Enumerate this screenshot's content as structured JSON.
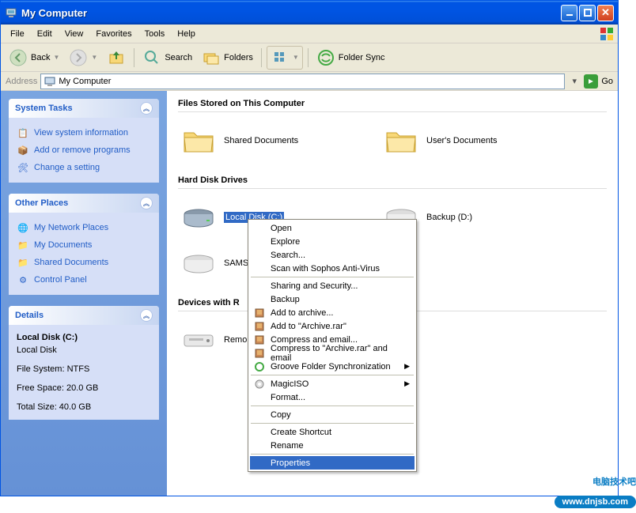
{
  "title": "My Computer",
  "menu": [
    "File",
    "Edit",
    "View",
    "Favorites",
    "Tools",
    "Help"
  ],
  "toolbar": {
    "back": "Back",
    "search": "Search",
    "folders": "Folders",
    "sync": "Folder Sync"
  },
  "address": {
    "label": "Address",
    "value": "My Computer",
    "go": "Go"
  },
  "sidebar": {
    "tasks": {
      "title": "System Tasks",
      "items": [
        "View system information",
        "Add or remove programs",
        "Change a setting"
      ]
    },
    "places": {
      "title": "Other Places",
      "items": [
        "My Network Places",
        "My Documents",
        "Shared Documents",
        "Control Panel"
      ]
    },
    "details": {
      "title": "Details",
      "name": "Local Disk (C:)",
      "type": "Local Disk",
      "fs": "File System: NTFS",
      "free": "Free Space: 20.0 GB",
      "total": "Total Size: 40.0 GB"
    }
  },
  "sections": {
    "files": {
      "title": "Files Stored on This Computer",
      "items": [
        "Shared Documents",
        "User's Documents"
      ]
    },
    "disks": {
      "title": "Hard Disk Drives",
      "items": [
        "Local Disk (C:)",
        "Backup (D:)",
        "SAMS"
      ]
    },
    "removable": {
      "title": "Devices with R",
      "items": [
        "Remo"
      ]
    }
  },
  "context_menu": [
    {
      "type": "item",
      "label": "Open"
    },
    {
      "type": "item",
      "label": "Explore"
    },
    {
      "type": "item",
      "label": "Search..."
    },
    {
      "type": "item",
      "label": "Scan with Sophos Anti-Virus"
    },
    {
      "type": "sep"
    },
    {
      "type": "item",
      "label": "Sharing and Security..."
    },
    {
      "type": "item",
      "label": "Backup"
    },
    {
      "type": "item",
      "label": "Add to archive...",
      "icon": "archive"
    },
    {
      "type": "item",
      "label": "Add to \"Archive.rar\"",
      "icon": "archive"
    },
    {
      "type": "item",
      "label": "Compress and email...",
      "icon": "archive"
    },
    {
      "type": "item",
      "label": "Compress to \"Archive.rar\" and email",
      "icon": "archive"
    },
    {
      "type": "item",
      "label": "Groove Folder Synchronization",
      "icon": "groove",
      "arrow": true
    },
    {
      "type": "sep"
    },
    {
      "type": "item",
      "label": "MagicISO",
      "icon": "magiciso",
      "arrow": true
    },
    {
      "type": "item",
      "label": "Format..."
    },
    {
      "type": "sep"
    },
    {
      "type": "item",
      "label": "Copy"
    },
    {
      "type": "sep"
    },
    {
      "type": "item",
      "label": "Create Shortcut"
    },
    {
      "type": "item",
      "label": "Rename"
    },
    {
      "type": "sep"
    },
    {
      "type": "item",
      "label": "Properties",
      "highlighted": true
    }
  ],
  "watermark": {
    "text": "电脑技术吧",
    "url": "www.dnjsb.com"
  }
}
